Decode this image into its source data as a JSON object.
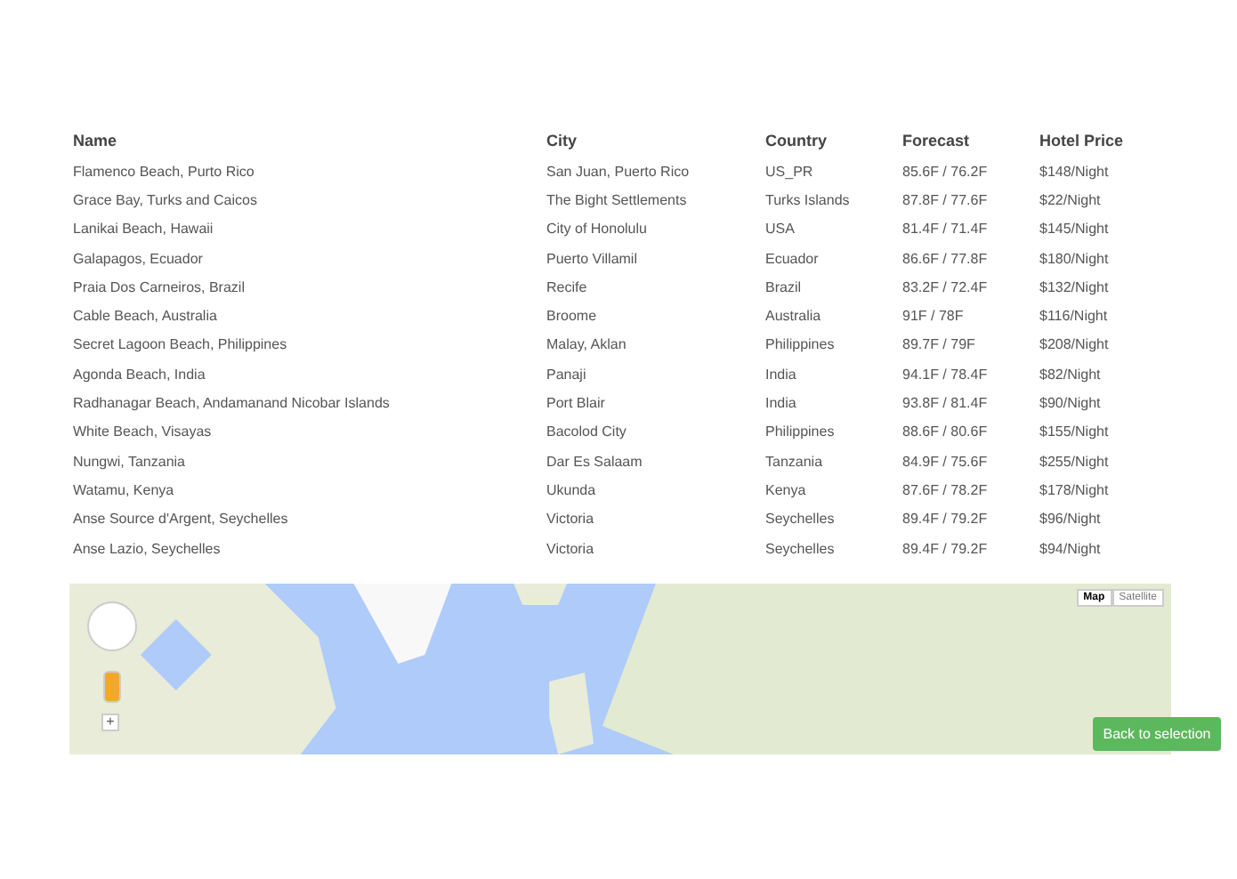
{
  "table": {
    "columns": [
      "Name",
      "City",
      "Country",
      "Forecast",
      "Hotel Price"
    ],
    "rows": [
      [
        "Flamenco Beach, Purto Rico",
        "San Juan, Puerto Rico",
        "US_PR",
        "85.6F / 76.2F",
        "$148/Night"
      ],
      [
        "Grace Bay, Turks and Caicos",
        "The Bight Settlements",
        "Turks Islands",
        "87.8F / 77.6F",
        "$22/Night"
      ],
      [
        "Lanikai Beach, Hawaii",
        "City of Honolulu",
        "USA",
        "81.4F / 71.4F",
        "$145/Night"
      ],
      [
        "Galapagos, Ecuador",
        "Puerto Villamil",
        "Ecuador",
        "86.6F / 77.8F",
        "$180/Night"
      ],
      [
        "Praia Dos Carneiros, Brazil",
        "Recife",
        "Brazil",
        "83.2F / 72.4F",
        "$132/Night"
      ],
      [
        "Cable Beach, Australia",
        "Broome",
        "Australia",
        "91F / 78F",
        "$116/Night"
      ],
      [
        "Secret Lagoon Beach, Philippines",
        "Malay, Aklan",
        "Philippines",
        "89.7F / 79F",
        "$208/Night"
      ],
      [
        "Agonda Beach, India",
        "Panaji",
        "India",
        "94.1F / 78.4F",
        "$82/Night"
      ],
      [
        "Radhanagar Beach, Andamanand Nicobar Islands",
        "Port Blair",
        "India",
        "93.8F / 81.4F",
        "$90/Night"
      ],
      [
        "White Beach, Visayas",
        "Bacolod City",
        "Philippines",
        "88.6F / 80.6F",
        "$155/Night"
      ],
      [
        "Nungwi, Tanzania",
        "Dar Es Salaam",
        "Tanzania",
        "84.9F / 75.6F",
        "$255/Night"
      ],
      [
        "Watamu, Kenya",
        "Ukunda",
        "Kenya",
        "87.6F / 78.2F",
        "$178/Night"
      ],
      [
        "Anse Source d'Argent, Seychelles",
        "Victoria",
        "Seychelles",
        "89.4F / 79.2F",
        "$96/Night"
      ],
      [
        "Anse Lazio, Seychelles",
        "Victoria",
        "Seychelles",
        "89.4F / 79.2F",
        "$94/Night"
      ]
    ]
  },
  "map": {
    "map_types": [
      {
        "label": "Map",
        "selected": true
      },
      {
        "label": "Satellite",
        "selected": false
      }
    ],
    "zoom_control": "+"
  },
  "back_button": "Back to selection"
}
